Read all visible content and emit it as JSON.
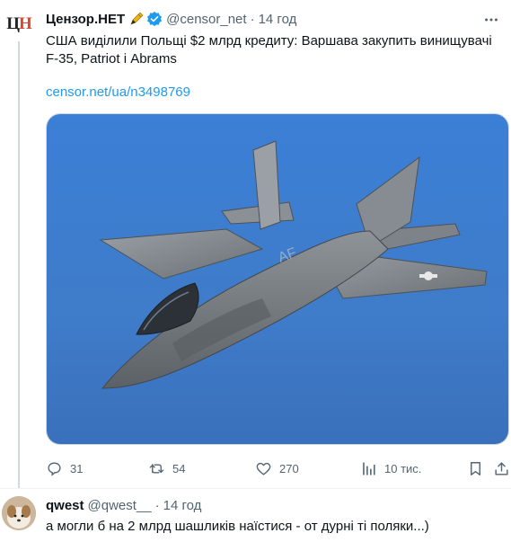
{
  "tweet": {
    "avatar_text_1": "Ц",
    "avatar_text_2": "Н",
    "name": "Цензор.НЕТ",
    "handle": "@censor_net",
    "separator": "·",
    "time": "14 год",
    "text": "США виділили Польщі $2 млрд кредиту: Варшава закупить винищувачі F-35, Patriot і Abrams",
    "link": "censor.net/ua/n3498769",
    "image_icon": "fighter-jet-photo",
    "actions": {
      "replies": "31",
      "retweets": "54",
      "likes": "270",
      "views": "10 тис."
    }
  },
  "reply": {
    "name": "qwest",
    "handle": "@qwest__",
    "separator": "·",
    "time": "14 год",
    "text": "а могли б на 2 млрд шашликів наїстися - от дурні ті поляки...)"
  },
  "colors": {
    "link": "#1d9bf0",
    "muted": "#536471",
    "verified": "#1d9bf0",
    "sky": "#3f7ed0"
  }
}
